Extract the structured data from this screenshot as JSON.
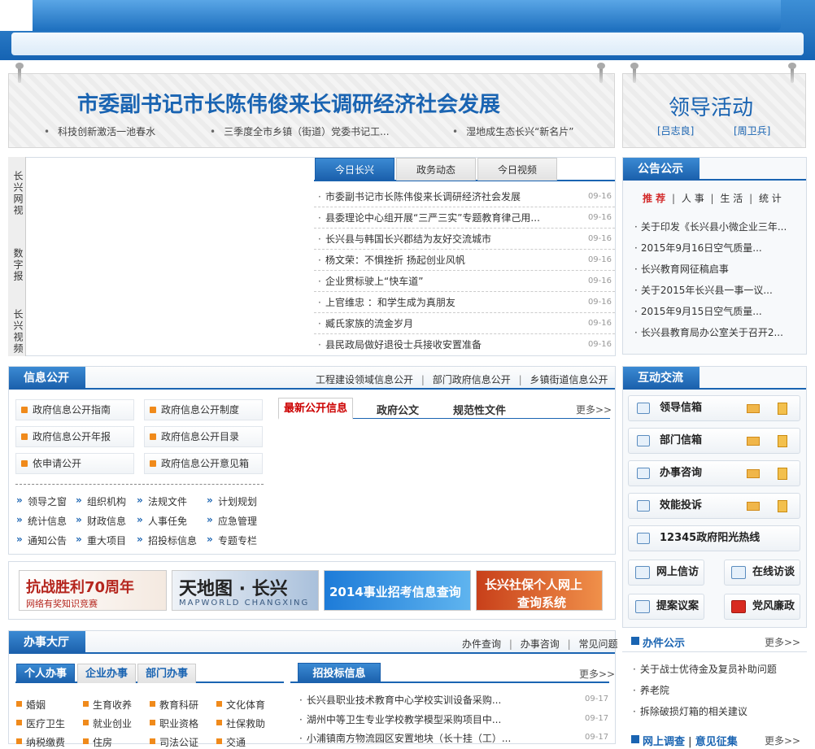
{
  "headline": {
    "title": "市委副书记市长陈伟俊来长调研经济社会发展",
    "subs": [
      "科技创新激活一池春水",
      "三季度全市乡镇（街道）党委书记工...",
      "湿地成生态长兴“新名片”"
    ]
  },
  "leader": {
    "title": "领导活动",
    "names": [
      "[吕志良]",
      "[周卫兵]"
    ]
  },
  "video_side": [
    "长兴网视",
    "数字报",
    "长兴视频"
  ],
  "news": {
    "tabs": [
      "今日长兴",
      "政务动态",
      "今日视频"
    ],
    "items": [
      {
        "title": "市委副书记市长陈伟俊来长调研经济社会发展",
        "date": "09-16"
      },
      {
        "title": "县委理论中心组开展“三严三实”专题教育律己用...",
        "date": "09-16"
      },
      {
        "title": "长兴县与韩国长兴郡结为友好交流城市",
        "date": "09-16"
      },
      {
        "title": "杨文荣：不惧挫折 扬起创业风帆",
        "date": "09-16"
      },
      {
        "title": "企业贯标驶上“快车道”",
        "date": "09-16"
      },
      {
        "title": "上官维忠 ：和学生成为真朋友",
        "date": "09-16"
      },
      {
        "title": "臧氏家族的流金岁月",
        "date": "09-16"
      },
      {
        "title": "县民政局做好退役士兵接收安置准备",
        "date": "09-16"
      }
    ]
  },
  "notice": {
    "title": "公告公示",
    "tabs": [
      "推 荐",
      "人 事",
      "生 活",
      "统 计"
    ],
    "items": [
      "关于印发《长兴县小微企业三年...",
      "2015年9月16日空气质量...",
      "长兴教育网征稿启事",
      "关于2015年长兴县一事一议...",
      "2015年9月15日空气质量...",
      "长兴县教育局办公室关于召开2..."
    ]
  },
  "info": {
    "title": "信息公开",
    "links": [
      "工程建设领域信息公开",
      "部门政府信息公开",
      "乡镇街道信息公开"
    ],
    "buttons": [
      "政府信息公开指南",
      "政府信息公开制度",
      "政府信息公开年报",
      "政府信息公开目录",
      "依申请公开",
      "政府信息公开意见箱"
    ],
    "quick": [
      "领导之窗",
      "组织机构",
      "法规文件",
      "计划规划",
      "统计信息",
      "财政信息",
      "人事任免",
      "应急管理",
      "通知公告",
      "重大项目",
      "招投标信息",
      "专题专栏"
    ],
    "tabs": [
      "最新公开信息",
      "政府公文",
      "规范性文件"
    ],
    "more": "更多>>"
  },
  "interact": {
    "title": "互动交流",
    "rows": [
      "领导信箱",
      "部门信箱",
      "办事咨询",
      "效能投诉",
      "12345政府阳光热线"
    ],
    "small": [
      "网上信访",
      "在线访谈",
      "提案议案",
      "党风廉政"
    ]
  },
  "ads": [
    {
      "text": "抗战胜利70周年",
      "sub": "网络有奖知识竞赛"
    },
    {
      "text": "天地图 · 长兴",
      "sub": "MAPWORLD CHANGXING"
    },
    {
      "text": "2014事业招考信息查询",
      "sub": ""
    },
    {
      "text": "长兴社保个人网上",
      "sub": "查询系统"
    }
  ],
  "hall": {
    "title": "办事大厅",
    "links": [
      "办件查询",
      "办事咨询",
      "常见问题"
    ],
    "tabs": [
      "个人办事",
      "企业办事",
      "部门办事"
    ],
    "services": [
      "婚姻",
      "生育收养",
      "教育科研",
      "文化体育",
      "医疗卫生",
      "就业创业",
      "职业资格",
      "社保救助",
      "纳税缴费",
      "住房",
      "司法公证",
      "交通"
    ]
  },
  "bid": {
    "title": "招投标信息",
    "more": "更多>>",
    "items": [
      {
        "title": "长兴县职业技术教育中心学校实训设备采购...",
        "date": "09-17"
      },
      {
        "title": "湖州中等卫生专业学校教学模型采购项目中...",
        "date": "09-17"
      },
      {
        "title": "小浦镇南方物流园区安置地块（长十挂（工）...",
        "date": "09-17"
      }
    ]
  },
  "banjian": {
    "title": "办件公示",
    "more": "更多>>",
    "items": [
      "关于战士优待金及复员补助问题",
      "养老院",
      "拆除破损灯箱的相关建议"
    ]
  },
  "survey": {
    "title": "网上调查",
    "title2": "意见征集",
    "more": "更多>>"
  }
}
